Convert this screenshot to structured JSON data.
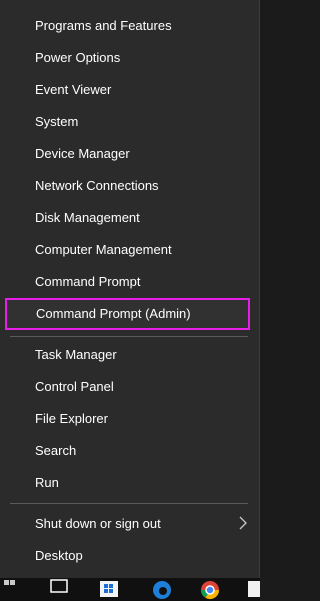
{
  "menu": {
    "items": [
      {
        "id": "programs-and-features",
        "label": "Programs and Features"
      },
      {
        "id": "power-options",
        "label": "Power Options"
      },
      {
        "id": "event-viewer",
        "label": "Event Viewer"
      },
      {
        "id": "system",
        "label": "System"
      },
      {
        "id": "device-manager",
        "label": "Device Manager"
      },
      {
        "id": "network-connections",
        "label": "Network Connections"
      },
      {
        "id": "disk-management",
        "label": "Disk Management"
      },
      {
        "id": "computer-management",
        "label": "Computer Management"
      },
      {
        "id": "command-prompt",
        "label": "Command Prompt"
      },
      {
        "id": "command-prompt-admin",
        "label": "Command Prompt (Admin)"
      },
      {
        "id": "task-manager",
        "label": "Task Manager"
      },
      {
        "id": "control-panel",
        "label": "Control Panel"
      },
      {
        "id": "file-explorer",
        "label": "File Explorer"
      },
      {
        "id": "search",
        "label": "Search"
      },
      {
        "id": "run",
        "label": "Run"
      },
      {
        "id": "shut-down-or-sign-out",
        "label": "Shut down or sign out"
      },
      {
        "id": "desktop",
        "label": "Desktop"
      }
    ],
    "highlighted_item": "command-prompt-admin",
    "highlight_color": "#e61ee6"
  },
  "taskbar": {
    "icons": [
      "start-icon",
      "task-view-icon",
      "store-icon",
      "edge-icon",
      "chrome-icon",
      "app-icon"
    ]
  }
}
